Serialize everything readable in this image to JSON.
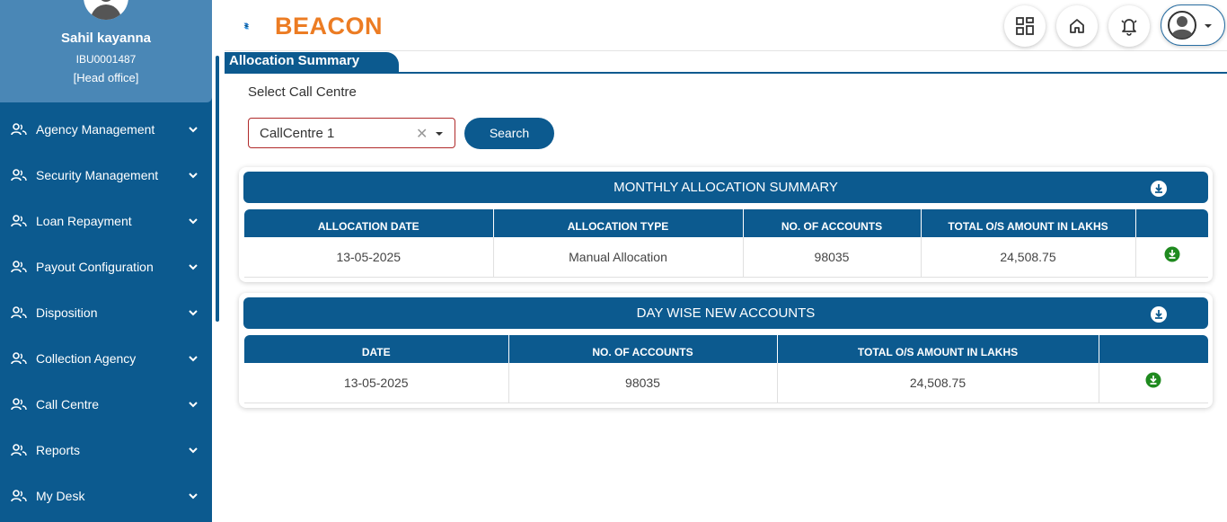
{
  "profile": {
    "name": "Sahil kayanna",
    "id": "IBU0001487",
    "office": "[Head office]"
  },
  "sidebar": {
    "items": [
      {
        "label": "Agency Management",
        "icon": "users-icon"
      },
      {
        "label": "Security Management",
        "icon": "users-icon"
      },
      {
        "label": "Loan Repayment",
        "icon": "users-icon"
      },
      {
        "label": "Payout Configuration",
        "icon": "users-icon"
      },
      {
        "label": "Disposition",
        "icon": "users-icon"
      },
      {
        "label": "Collection Agency",
        "icon": "users-icon"
      },
      {
        "label": "Call Centre",
        "icon": "users-icon"
      },
      {
        "label": "Reports",
        "icon": "users-icon"
      },
      {
        "label": "My Desk",
        "icon": "users-icon"
      }
    ]
  },
  "header": {
    "logo_text": "BEACON",
    "icons": [
      "grid-icon",
      "home-icon",
      "bell-icon",
      "user-icon"
    ]
  },
  "page": {
    "tab_title": "Allocation Summary",
    "select_label": "Select Call Centre",
    "select_value": "CallCentre 1",
    "search_label": "Search"
  },
  "monthly": {
    "title": "MONTHLY ALLOCATION SUMMARY",
    "columns": [
      "ALLOCATION DATE",
      "ALLOCATION TYPE",
      "NO. OF ACCOUNTS",
      "TOTAL O/S AMOUNT IN LAKHS",
      ""
    ],
    "rows": [
      {
        "date": "13-05-2025",
        "type": "Manual Allocation",
        "accounts": "98035",
        "amount": "24,508.75"
      }
    ]
  },
  "daywise": {
    "title": "DAY WISE NEW ACCOUNTS",
    "columns": [
      "DATE",
      "NO. OF ACCOUNTS",
      "TOTAL O/S AMOUNT IN LAKHS",
      ""
    ],
    "rows": [
      {
        "date": "13-05-2025",
        "accounts": "98035",
        "amount": "24,508.75"
      }
    ]
  },
  "colors": {
    "primary": "#0c5a8f",
    "profile_bg": "#4a87b6",
    "accent_orange": "#ec7c23",
    "download_green": "#1f8a1f"
  }
}
